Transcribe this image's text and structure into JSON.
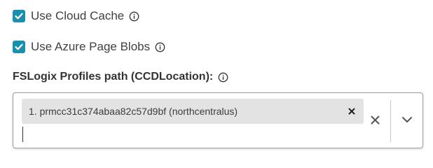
{
  "options": {
    "use_cloud_cache": {
      "label": "Use Cloud Cache",
      "checked": true
    },
    "use_azure_page_blobs": {
      "label": "Use Azure Page Blobs",
      "checked": true
    }
  },
  "profiles_path": {
    "label": "FSLogix Profiles path (CCDLocation):",
    "selected_items": [
      {
        "text": "1. prmcc31c374abaa82c57d9bf (northcentralus)"
      }
    ],
    "input_value": ""
  },
  "colors": {
    "accent": "#1b8fae",
    "chip_bg": "#e3e3e3",
    "border": "#9aa0a6"
  },
  "icons": [
    "checkmark-icon",
    "info-icon",
    "close-icon",
    "chevron-down-icon"
  ]
}
